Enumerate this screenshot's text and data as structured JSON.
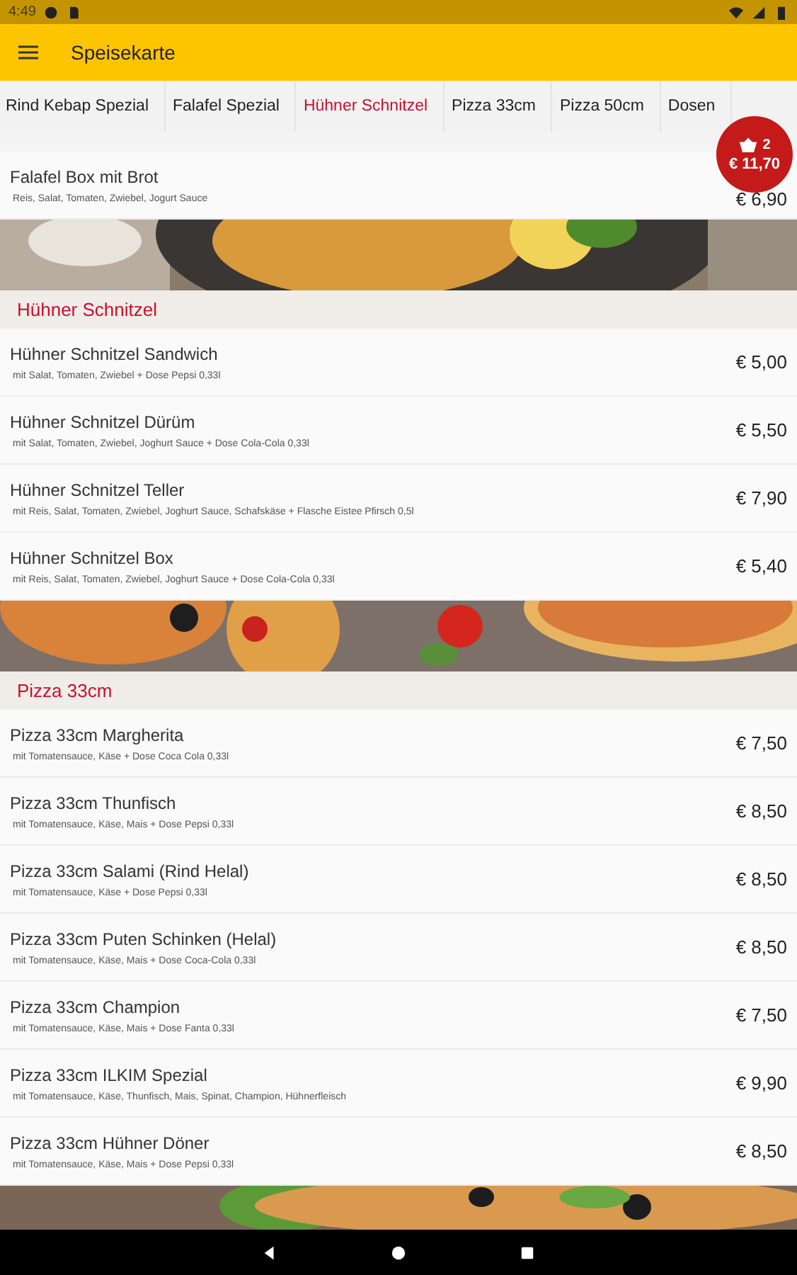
{
  "status_bar": {
    "time": "4:49"
  },
  "app_bar": {
    "title": "Speisekarte"
  },
  "tabs": [
    {
      "label": "Rind Kebap Spezial",
      "selected": false
    },
    {
      "label": "Falafel Spezial",
      "selected": false
    },
    {
      "label": "Hühner Schnitzel",
      "selected": true
    },
    {
      "label": "Pizza 33cm",
      "selected": false
    },
    {
      "label": "Pizza 50cm",
      "selected": false
    },
    {
      "label": "Dosen",
      "selected": false
    }
  ],
  "cart": {
    "count": "2",
    "total": "€ 11,70"
  },
  "sections": [
    {
      "kind": "items",
      "items": [
        {
          "name": "Falafel Box mit Brot",
          "description": "Reis, Salat, Tomaten, Zwiebel, Jogurt Sauce",
          "price": "€ 6,90"
        }
      ]
    },
    {
      "kind": "picture"
    },
    {
      "kind": "header",
      "title": "Hühner Schnitzel"
    },
    {
      "kind": "items",
      "items": [
        {
          "name": "Hühner Schnitzel Sandwich",
          "description": "mit Salat, Tomaten, Zwiebel + Dose Pepsi 0,33l",
          "price": "€ 5,00"
        },
        {
          "name": "Hühner Schnitzel Dürüm",
          "description": "mit Salat, Tomaten, Zwiebel, Joghurt Sauce + Dose Cola-Cola 0,33l",
          "price": "€ 5,50"
        },
        {
          "name": "Hühner Schnitzel Teller",
          "description": "mit Reis, Salat, Tomaten, Zwiebel, Joghurt Sauce, Schafskäse + Flasche Eistee Pfirsch 0,5l",
          "price": "€ 7,90"
        },
        {
          "name": "Hühner Schnitzel Box",
          "description": "mit Reis, Salat, Tomaten, Zwiebel, Joghurt Sauce + Dose Cola-Cola 0,33l",
          "price": "€ 5,40"
        }
      ]
    },
    {
      "kind": "picture"
    },
    {
      "kind": "header",
      "title": "Pizza 33cm"
    },
    {
      "kind": "items",
      "items": [
        {
          "name": "Pizza 33cm Margherita",
          "description": "mit Tomatensauce, Käse + Dose Coca Cola 0,33l",
          "price": "€ 7,50"
        },
        {
          "name": "Pizza 33cm Thunfisch",
          "description": "mit Tomatensauce, Käse, Mais + Dose Pepsi 0,33l",
          "price": "€ 8,50"
        },
        {
          "name": "Pizza 33cm Salami (Rind Helal)",
          "description": "mit Tomatensauce, Käse + Dose Pepsi 0,33l",
          "price": "€ 8,50"
        },
        {
          "name": "Pizza 33cm Puten Schinken (Helal)",
          "description": "mit Tomatensauce, Käse, Mais + Dose Coca-Cola 0,33l",
          "price": "€ 8,50"
        },
        {
          "name": "Pizza 33cm Champion",
          "description": "mit Tomatensauce, Käse, Mais + Dose Fanta 0,33l",
          "price": "€ 7,50"
        },
        {
          "name": "Pizza 33cm ILKIM Spezial",
          "description": "mit Tomatensauce, Käse, Thunfisch, Mais, Spinat, Champion, Hühnerfleisch",
          "price": "€ 9,90"
        },
        {
          "name": "Pizza 33cm Hühner Döner",
          "description": "mit Tomatensauce, Käse, Mais + Dose Pepsi 0,33l",
          "price": "€ 8,50"
        }
      ]
    },
    {
      "kind": "picture"
    }
  ]
}
